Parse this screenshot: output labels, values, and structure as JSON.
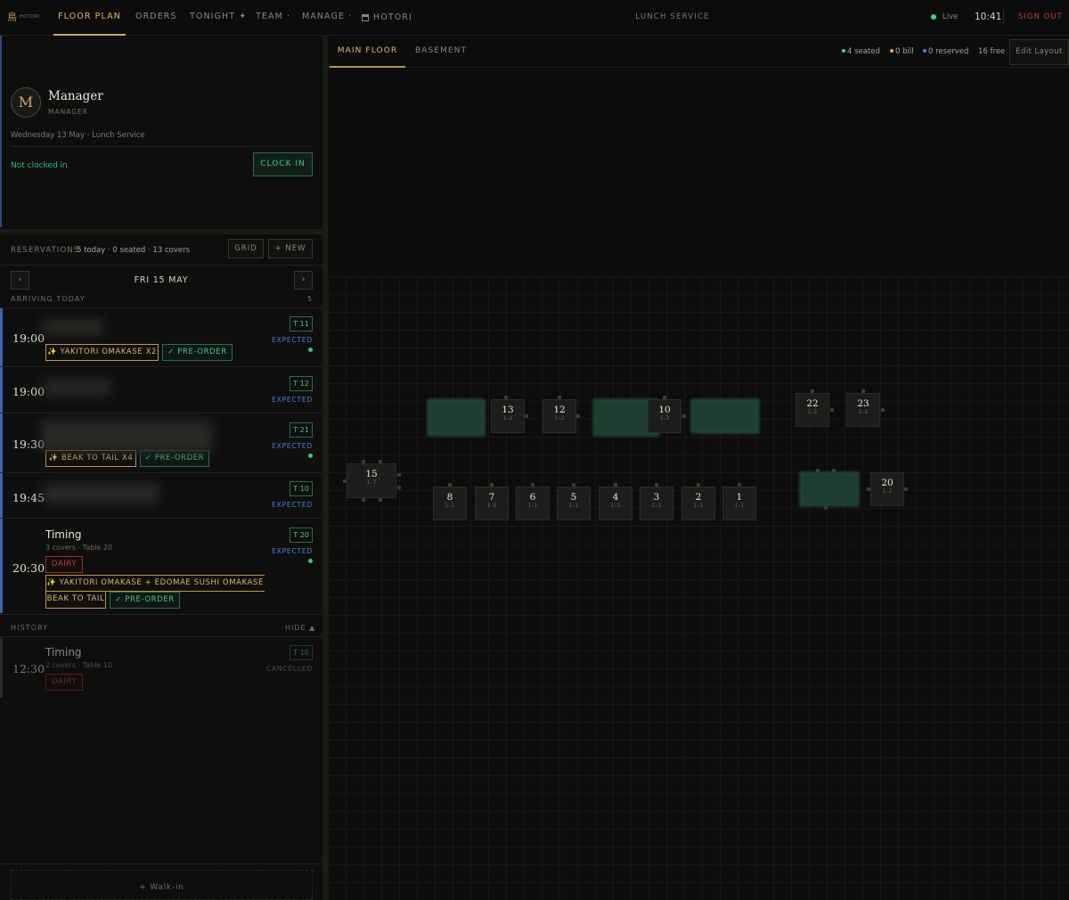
{
  "nav": {
    "logo_kanji": "鳥",
    "logo_word": "HOTORI",
    "items": [
      {
        "label": "FLOOR PLAN",
        "active": true
      },
      {
        "label": "ORDERS"
      },
      {
        "label": "TONIGHT ✦"
      },
      {
        "label": "TEAM ·"
      },
      {
        "label": "MANAGE ·"
      },
      {
        "label": "HOTORI",
        "icon": "restaurant-icon"
      }
    ],
    "service": "LUNCH SERVICE",
    "live": "Live",
    "time": "10:41",
    "sign_out": "SIGN OUT"
  },
  "profile": {
    "initial": "M",
    "name": "Manager",
    "role": "MANAGER",
    "date_line": "Wednesday 13 May · Lunch Service",
    "clock_status": "Not clocked in",
    "clock_in": "CLOCK IN"
  },
  "reservations": {
    "title": "RESERVATIONS",
    "summary": "5 today · 0 seated · 13 covers",
    "grid_btn": "GRID",
    "new_btn": "+ NEW",
    "prev": "‹",
    "next": "›",
    "day": "FRI 15 MAY",
    "arriving_label": "ARRIVING TODAY",
    "arriving_count": "5",
    "rows": [
      {
        "time": "19:00",
        "table": "T 11",
        "status": "EXPECTED",
        "chips": [
          "✨ YAKITORI OMAKASE X2",
          "✓ PRE-ORDER"
        ]
      },
      {
        "time": "19:00",
        "table": "T 12",
        "status": "EXPECTED"
      },
      {
        "time": "19:30",
        "table": "T 21",
        "status": "EXPECTED",
        "chips": [
          "✨ BEAK TO TAIL X4",
          "✓ PRE-ORDER"
        ]
      },
      {
        "time": "19:45",
        "table": "T 10",
        "status": "EXPECTED"
      },
      {
        "time": "20:30",
        "name": "Timing",
        "sub": "3 covers · Table 20",
        "table": "T 20",
        "status": "EXPECTED",
        "tag": "DAIRY",
        "chips": [
          "✨ YAKITORI OMAKASE + EDOMAE SUSHI OMAKASE +",
          "BEAK TO TAIL",
          "✓ PRE-ORDER"
        ]
      }
    ],
    "history_label": "HISTORY",
    "hide_label": "HIDE ▲",
    "history": {
      "time": "12:30",
      "name": "Timing",
      "sub": "2 covers · Table 10",
      "table": "T 10",
      "status": "CANCELLED",
      "tag": "DAIRY"
    },
    "walkin": "+ Walk-in"
  },
  "floor": {
    "tabs": [
      "MAIN FLOOR",
      "BASEMENT"
    ],
    "stats": {
      "seated": "4 seated",
      "bill": "0 bill",
      "reserved": "0 reserved",
      "free": "16 free"
    },
    "edit_layout": "Edit Layout",
    "colors": {
      "seated": "#3bd889",
      "bill": "#e0a955",
      "reserved": "#4a7fd4",
      "occupied": "#1e3d30"
    },
    "tables": [
      {
        "num": "",
        "occupied": true
      },
      {
        "num": "13",
        "cap": "1–2"
      },
      {
        "num": "12",
        "cap": "1–2"
      },
      {
        "num": "",
        "occupied": true
      },
      {
        "num": "10",
        "cap": "1–2"
      },
      {
        "num": "",
        "occupied": true
      },
      {
        "num": "22",
        "cap": "1–2"
      },
      {
        "num": "23",
        "cap": "1–2"
      },
      {
        "num": "15",
        "cap": "1–7"
      },
      {
        "num": "8",
        "cap": "1–1"
      },
      {
        "num": "7",
        "cap": "1–1"
      },
      {
        "num": "6",
        "cap": "1–1"
      },
      {
        "num": "5",
        "cap": "1–1"
      },
      {
        "num": "4",
        "cap": "1–1"
      },
      {
        "num": "3",
        "cap": "1–1"
      },
      {
        "num": "2",
        "cap": "1–1"
      },
      {
        "num": "1",
        "cap": "1–1"
      },
      {
        "num": "",
        "occupied": true
      },
      {
        "num": "20",
        "cap": "1–2"
      }
    ]
  }
}
